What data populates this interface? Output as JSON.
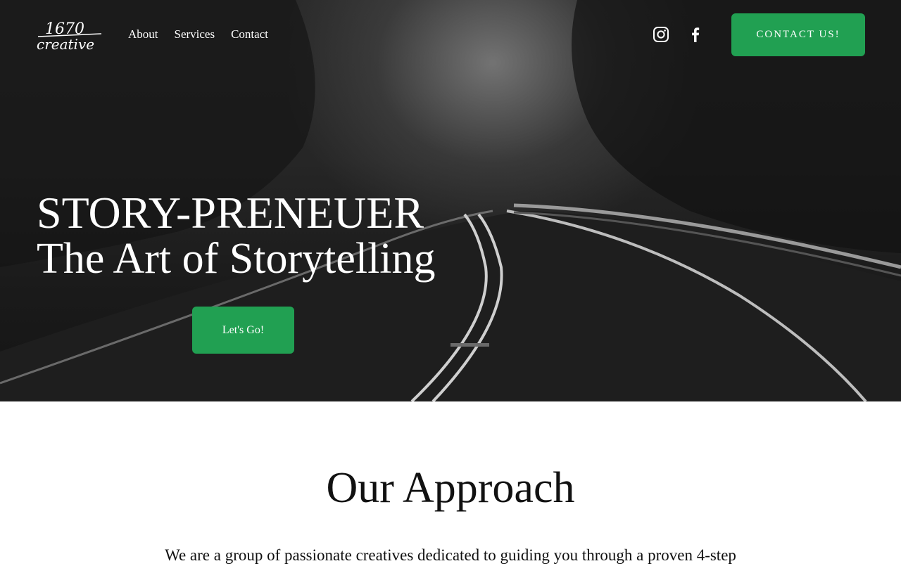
{
  "brand": {
    "logo_line1": "1670",
    "logo_line2": "creative"
  },
  "nav": {
    "items": [
      {
        "label": "About"
      },
      {
        "label": "Services"
      },
      {
        "label": "Contact"
      }
    ]
  },
  "social": {
    "icons": [
      "instagram-icon",
      "facebook-icon"
    ]
  },
  "header": {
    "cta_label": "CONTACT US!"
  },
  "hero": {
    "title_line1": "STORY-PRENEUER",
    "title_line2": "The Art of Storytelling",
    "button_label": "Let's Go!"
  },
  "approach": {
    "heading": "Our Approach",
    "body": "We are a group of passionate creatives dedicated to guiding you through a proven 4-step"
  },
  "colors": {
    "accent": "#21a052",
    "hero_text": "#ffffff",
    "body_text": "#111111"
  }
}
